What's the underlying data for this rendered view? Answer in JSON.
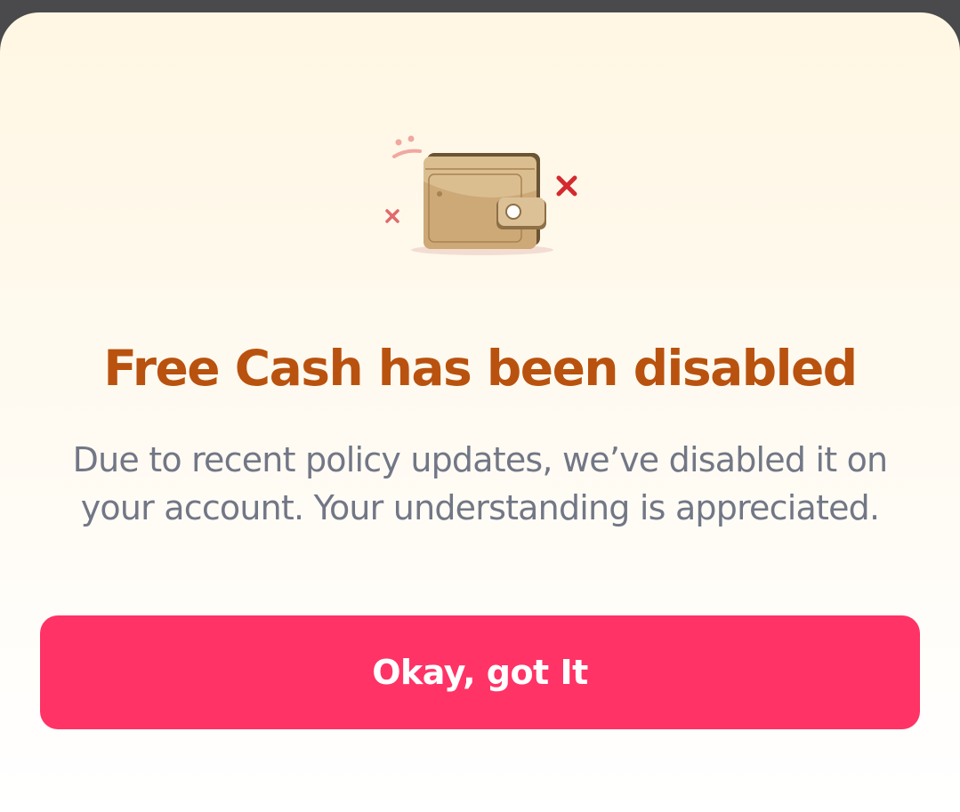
{
  "dialog": {
    "illustration_icon": "wallet-disabled-icon",
    "title": "Free Cash has been disabled",
    "message": "Due to recent policy updates, we’ve disabled it on your account. Your understanding is appreciated.",
    "confirm_label": "Okay, got It"
  },
  "colors": {
    "title": "#b9520f",
    "message": "#727786",
    "button_bg": "#ff3366",
    "button_text": "#ffffff",
    "sheet_top": "#fff7e3",
    "overlay": "#4a4a4d",
    "cross_mark": "#d42a2f"
  }
}
